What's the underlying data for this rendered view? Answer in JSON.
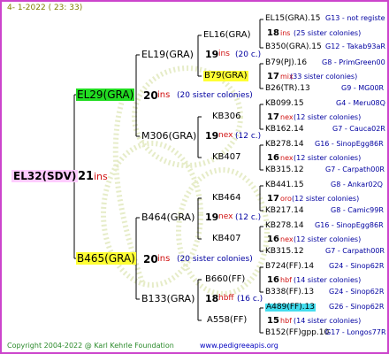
{
  "header": {
    "date_text": "4-  1-2022 ( 23: 33)"
  },
  "footer": {
    "copyright": "Copyright 2004-2022 @ Karl Kehrle Foundation",
    "url": "www.pedigreeapis.org"
  },
  "colors": {
    "frame": "#cc44cc",
    "queen": "#d01010",
    "line": "#000000",
    "link": "#0000c0",
    "note": "#808000"
  },
  "root": {
    "name": "EL32(SDV)",
    "year": "21",
    "suffix": "ins"
  },
  "gen1": [
    {
      "name": "EL29(GRA)",
      "year": "20",
      "suffix": "ins",
      "note": "(20 sister colonies)"
    },
    {
      "name": "B465(GRA)",
      "year": "20",
      "suffix": "ins",
      "note": "(20 sister colonies)"
    }
  ],
  "gen2": [
    {
      "name": "EL19(GRA)",
      "year": "19",
      "suffix": "ins",
      "note": "(20 c.)"
    },
    {
      "name": "M306(GRA)",
      "year": "19",
      "suffix": "nex",
      "note": "(12 c.)"
    },
    {
      "name": "B464(GRA)",
      "year": "19",
      "suffix": "nex",
      "note": "(12 c.)"
    },
    {
      "name": "B133(GRA)",
      "year": "18",
      "suffix": "hbff",
      "note": "(16 c.)"
    }
  ],
  "gen3": [
    {
      "name": "EL16(GRA)"
    },
    {
      "name": "B79(GRA)"
    },
    {
      "name": "KB306"
    },
    {
      "name": "KB407"
    },
    {
      "name": "KB464"
    },
    {
      "name": "KB407"
    },
    {
      "name": "B660(FF)"
    },
    {
      "name": "A558(FF)"
    }
  ],
  "gen4": [
    {
      "top": "EL15(GRA).15",
      "top_code": "G13 - not registe",
      "year": "18",
      "suffix": "ins",
      "note": "(25 sister colonies)",
      "bottom": "B350(GRA).15",
      "bottom_code": "G12 - Takab93aR"
    },
    {
      "top": "B79(PJ).16",
      "top_code": "G8 - PrimGreen00",
      "year": "17",
      "suffix": "mix",
      "note": "(33 sister colonies)",
      "bottom": "B26(TR).13",
      "bottom_code": "G9 - MG00R"
    },
    {
      "top": "KB099.15",
      "top_code": "G4 - Meru08Q",
      "year": "17",
      "suffix": "nex",
      "note": "(12 sister colonies)",
      "bottom": "KB162.14",
      "bottom_code": "G7 - Cauca02R"
    },
    {
      "top": "KB278.14",
      "top_code": "G16 - SinopEgg86R",
      "year": "16",
      "suffix": "nex",
      "note": "(12 sister colonies)",
      "bottom": "KB315.12",
      "bottom_code": "G7 - Carpath00R"
    },
    {
      "top": "KB441.15",
      "top_code": "G8 - Ankar02Q",
      "year": "17",
      "suffix": "oro",
      "note": "(12 sister colonies)",
      "bottom": "KB217.14",
      "bottom_code": "G8 - Camic99R"
    },
    {
      "top": "KB278.14",
      "top_code": "G16 - SinopEgg86R",
      "year": "16",
      "suffix": "nex",
      "note": "(12 sister colonies)",
      "bottom": "KB315.12",
      "bottom_code": "G7 - Carpath00R"
    },
    {
      "top": "B724(FF).14",
      "top_code": "G24 - Sinop62R",
      "year": "16",
      "suffix": "hbf",
      "note": "(14 sister colonies)",
      "bottom": "B338(FF).13",
      "bottom_code": "G24 - Sinop62R"
    },
    {
      "top": "A489(FF).13",
      "top_code": "G26 - Sinop62R",
      "year": "15",
      "suffix": "hbf",
      "note": "(14 sister colonies)",
      "bottom": "B152(FF)gpp.10",
      "bottom_code": "G17 - Longos77R"
    }
  ]
}
